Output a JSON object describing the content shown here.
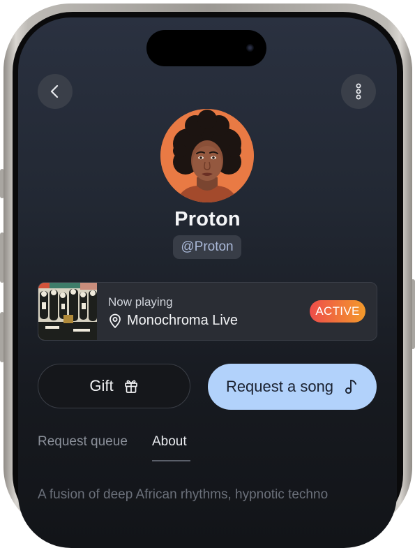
{
  "profile": {
    "name": "Proton",
    "handle": "@Proton"
  },
  "now_playing": {
    "label": "Now playing",
    "title": "Monochroma Live",
    "status": "ACTIVE"
  },
  "actions": {
    "gift_label": "Gift",
    "request_label": "Request a song"
  },
  "tabs": [
    {
      "label": "Request queue",
      "active": false
    },
    {
      "label": "About",
      "active": true
    }
  ],
  "about": {
    "text": "A fusion of deep African rhythms, hypnotic techno"
  },
  "colors": {
    "accent_blue": "#b2d2fb",
    "avatar_bg": "#e97a44",
    "badge_start": "#ee4d4a",
    "badge_end": "#f39a2b"
  },
  "icons": {
    "back": "chevron-left-icon",
    "more": "more-vertical-icon",
    "location": "location-pin-icon",
    "gift": "gift-icon",
    "music": "music-note-icon"
  }
}
